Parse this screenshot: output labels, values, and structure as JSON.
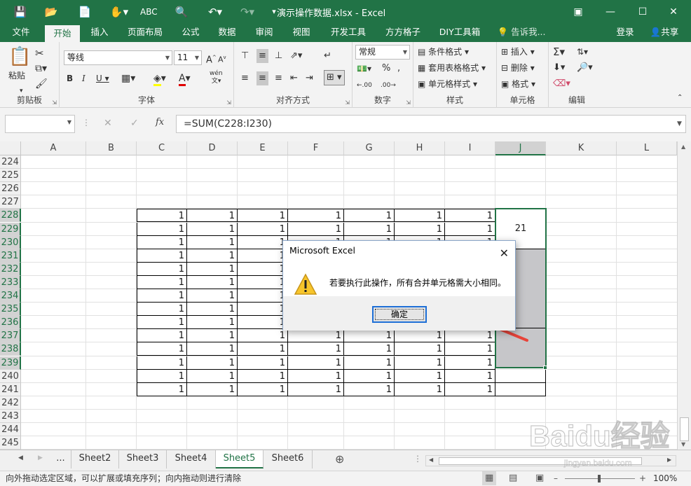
{
  "titlebar": {
    "title": "演示操作数据.xlsx - Excel",
    "colors": {
      "brand": "#217346"
    }
  },
  "ribbon_tabs": [
    "文件",
    "开始",
    "插入",
    "页面布局",
    "公式",
    "数据",
    "审阅",
    "视图",
    "开发工具",
    "方方格子",
    "DIY工具箱"
  ],
  "tell_me": "告诉我...",
  "account": {
    "login": "登录",
    "share": "共享"
  },
  "ribbon": {
    "clipboard": {
      "label": "剪贴板",
      "paste": "粘贴"
    },
    "font": {
      "label": "字体",
      "font_name": "等线",
      "font_size": "11",
      "phonetic": "wén"
    },
    "alignment": {
      "label": "对齐方式"
    },
    "number": {
      "label": "数字",
      "format": "常规"
    },
    "styles": {
      "label": "样式",
      "conditional": "条件格式",
      "table": "套用表格格式",
      "cell_styles": "单元格样式"
    },
    "cells": {
      "label": "单元格",
      "insert": "插入",
      "delete": "删除",
      "format": "格式"
    },
    "editing": {
      "label": "编辑"
    }
  },
  "formula_bar": {
    "name_box": "",
    "formula": "=SUM(C228:I230)",
    "fx": "fx"
  },
  "columns": [
    "A",
    "B",
    "C",
    "D",
    "E",
    "F",
    "G",
    "H",
    "I",
    "J",
    "K",
    "L"
  ],
  "rows": [
    "224",
    "225",
    "226",
    "227",
    "228",
    "229",
    "230",
    "231",
    "232",
    "233",
    "234",
    "235",
    "236",
    "237",
    "238",
    "239",
    "240",
    "241",
    "242",
    "243",
    "244",
    "245"
  ],
  "cell_value": "1",
  "merged_value": "21",
  "dialog": {
    "title": "Microsoft Excel",
    "message": "若要执行此操作，所有合并单元格需大小相同。",
    "ok": "确定"
  },
  "sheets": [
    "...",
    "Sheet2",
    "Sheet3",
    "Sheet4",
    "Sheet5",
    "Sheet6"
  ],
  "active_sheet": "Sheet5",
  "status": {
    "message": "向外拖动选定区域，可以扩展或填充序列；向内拖动则进行清除",
    "zoom": "100%"
  },
  "watermark": {
    "text": "Baidu经验",
    "sub": "jingyan.baidu.com"
  }
}
